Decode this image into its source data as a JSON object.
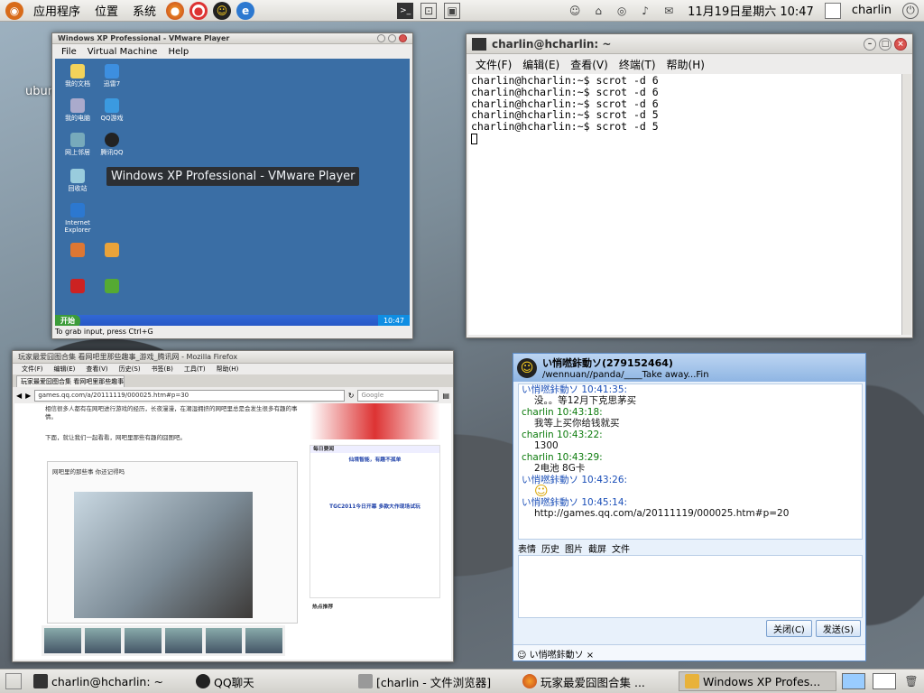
{
  "top_panel": {
    "menu": [
      "应用程序",
      "位置",
      "系统"
    ],
    "datetime": "11月19日星期六 10:47",
    "user": "charlin"
  },
  "desktop": {
    "label": "ubun"
  },
  "terminal": {
    "title": "charlin@hcharlin: ~",
    "menu": [
      "文件(F)",
      "编辑(E)",
      "查看(V)",
      "终端(T)",
      "帮助(H)"
    ],
    "lines": [
      "charlin@hcharlin:~$ scrot -d 6",
      "charlin@hcharlin:~$ scrot -d 6",
      "charlin@hcharlin:~$ scrot -d 6",
      "charlin@hcharlin:~$ scrot -d 5",
      "charlin@hcharlin:~$ scrot -d 5"
    ]
  },
  "vmware": {
    "title": "Windows XP Professional - VMware Player",
    "menu": [
      "File",
      "Virtual Machine",
      "Help"
    ],
    "start_label": "开始",
    "clock": "10:47",
    "status": "To grab input, press Ctrl+G",
    "tooltip": "Windows XP Professional - VMware Player",
    "icons": [
      "我的文档",
      "迅雷7",
      "我的电脑",
      "QQ游戏",
      "回收站",
      "Internet Explorer",
      "网上邻居",
      "腾讯QQ"
    ]
  },
  "firefox": {
    "title": "玩家最爱囧图合集 看网吧里那些趣事_游戏_腾讯网 - Mozilla Firefox",
    "menu": [
      "文件(F)",
      "编辑(E)",
      "查看(V)",
      "历史(S)",
      "书签(B)",
      "工具(T)",
      "帮助(H)"
    ],
    "tab": "玩家最爱囧图合集 看网吧里那些趣事",
    "url": "games.qq.com/a/20111119/000025.htm#p=30",
    "search_placeholder": "Google",
    "article_p1": "相信很多人都有在网吧进行游戏的经历，长夜漫漫，在潮湿拥挤的网吧里总是会发生很多有趣的事情。",
    "article_p2": "下面，就让我们一起看看，网吧里那些有趣的囧图吧。",
    "caption": "网吧里的那些事 你还记得吗",
    "sidebar_title": "每日要闻",
    "sidebar_headline1": "仙境智能，有趣不孤单",
    "sidebar_headline2": "TGC2011今日开幕 多款大作现场试玩",
    "sidebar_section2": "热点推荐"
  },
  "qq": {
    "contact": "い悄嘫鉲動ソ(279152464)",
    "signature": "/wennuan//panda/____Take away...Fin",
    "messages": [
      {
        "sender": "い悄嘫鉲動ソ 10:41:35:",
        "text": "没。。等12月下克思茅买",
        "who": "them"
      },
      {
        "sender": "charlin 10:43:18:",
        "text": "我等上买你给钱就买",
        "who": "me"
      },
      {
        "sender": "charlin 10:43:22:",
        "text": "1300",
        "who": "me"
      },
      {
        "sender": "charlin 10:43:29:",
        "text": "2电池 8G卡",
        "who": "me"
      },
      {
        "sender": "い悄嘫鉲動ソ 10:43:26:",
        "text": "☺",
        "who": "them"
      },
      {
        "sender": "い悄嘫鉲動ソ 10:45:14:",
        "text": "http://games.qq.com/a/20111119/000025.htm#p=20",
        "who": "them"
      }
    ],
    "toolbar": [
      "表情",
      "历史",
      "图片",
      "截屏",
      "文件"
    ],
    "close_label": "关闭(C)",
    "send_label": "发送(S)",
    "tab_label": "い悄嘫鉲動ソ"
  },
  "bottom_panel": {
    "tasks": [
      "charlin@hcharlin: ~",
      "QQ聊天",
      "[charlin - 文件浏览器]",
      "玩家最爱囧图合集 ...",
      "Windows XP Profes..."
    ]
  }
}
